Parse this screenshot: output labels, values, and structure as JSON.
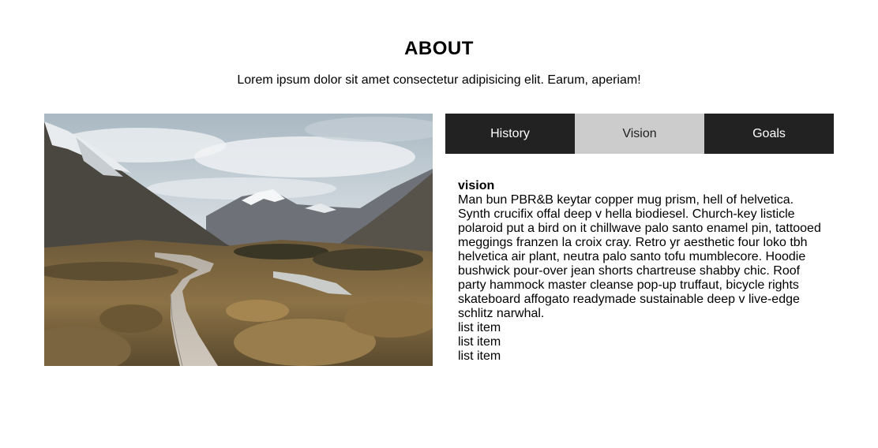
{
  "about": {
    "title": "ABOUT",
    "subtitle": "Lorem ipsum dolor sit amet consectetur adipisicing elit. Earum, aperiam!"
  },
  "tabs": [
    {
      "label": "History",
      "active": false
    },
    {
      "label": "Vision",
      "active": true
    },
    {
      "label": "Goals",
      "active": false
    }
  ],
  "content": {
    "heading": "vision",
    "body": "Man bun PBR&B keytar copper mug prism, hell of helvetica. Synth crucifix offal deep v hella biodiesel. Church-key listicle polaroid put a bird on it chillwave palo santo enamel pin, tattooed meggings franzen la croix cray. Retro yr aesthetic four loko tbh helvetica air plant, neutra palo santo tofu mumblecore. Hoodie bushwick pour-over jean shorts chartreuse shabby chic. Roof party hammock master cleanse pop-up truffaut, bicycle rights skateboard affogato readymade sustainable deep v live-edge schlitz narwhal.",
    "list_items": [
      "list item",
      "list item",
      "list item"
    ]
  },
  "colors": {
    "tab_dark": "#222222",
    "tab_active": "#cccccc",
    "text": "#000000"
  },
  "icons": {
    "image": "mountain-landscape-image"
  }
}
